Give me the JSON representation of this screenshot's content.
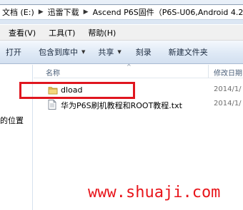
{
  "address": {
    "crumbs": [
      "文档 (E:)",
      "迅雷下载",
      "Ascend P6S固件（P6S-U06,Android 4.2"
    ],
    "separator": "▶"
  },
  "menubar": {
    "items": [
      "查看(V)",
      "工具(T)",
      "帮助(H)"
    ]
  },
  "toolbar": {
    "open": "打开",
    "include_library": "包含到库中",
    "share": "共享",
    "burn": "刻录",
    "new_folder": "新建文件夹",
    "dropdown_arrow": "▼"
  },
  "nav": {
    "label": "的位置"
  },
  "columns": {
    "name": "名称",
    "sort_indicator": "^",
    "modified": "修改日期"
  },
  "files": [
    {
      "name": "dload",
      "icon": "folder-icon",
      "date": "2014/1/"
    },
    {
      "name": "华为P6S刷机教程和ROOT教程.txt",
      "icon": "text-file-icon",
      "date": "2014/1/"
    }
  ],
  "watermark": "www.shuaji.com",
  "colors": {
    "highlight": "#e0161f",
    "watermark": "#e8151b",
    "folder": "#e8c45a"
  }
}
